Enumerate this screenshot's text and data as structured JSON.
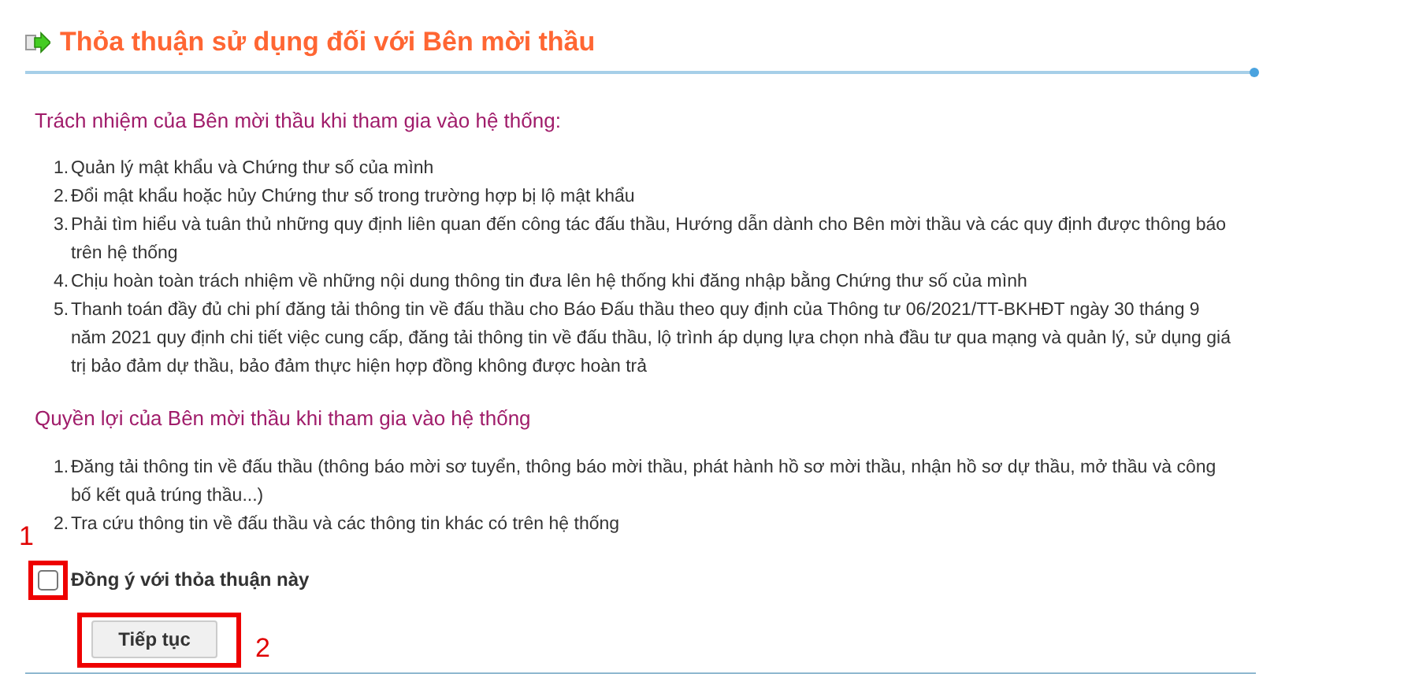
{
  "title": "Thỏa thuận sử dụng đối với Bên mời thầu",
  "sections": [
    {
      "heading": "Trách nhiệm của Bên mời thầu khi tham gia vào hệ thống:",
      "items": [
        {
          "number": "1.",
          "text": "Quản lý mật khẩu và Chứng thư số của mình"
        },
        {
          "number": "2.",
          "text": "Đổi mật khẩu hoặc hủy Chứng thư số trong trường hợp bị lộ mật khẩu"
        },
        {
          "number": "3.",
          "text": "Phải tìm hiểu và tuân thủ những quy định liên quan đến công tác đấu thầu, Hướng dẫn dành cho Bên mời thầu và các quy định được thông báo trên hệ thống"
        },
        {
          "number": "4.",
          "text": "Chịu hoàn toàn trách nhiệm về những nội dung thông tin đưa lên hệ thống khi đăng nhập bằng Chứng thư số của mình"
        },
        {
          "number": "5.",
          "text": "Thanh toán đầy đủ chi phí đăng tải thông tin về đấu thầu cho Báo Đấu thầu theo quy định của Thông tư 06/2021/TT-BKHĐT ngày 30 tháng 9 năm 2021 quy định chi tiết việc cung cấp, đăng tải thông tin về đấu thầu, lộ trình áp dụng lựa chọn nhà đầu tư qua mạng và quản lý, sử dụng giá trị bảo đảm dự thầu, bảo đảm thực hiện hợp đồng không được hoàn trả"
        }
      ]
    },
    {
      "heading": "Quyền lợi của Bên mời thầu khi tham gia vào hệ thống",
      "items": [
        {
          "number": "1.",
          "text": "Đăng tải thông tin về đấu thầu (thông báo mời sơ tuyển, thông báo mời thầu, phát hành hồ sơ mời thầu, nhận hồ sơ dự thầu, mở thầu và công bố kết quả trúng thầu...)"
        },
        {
          "number": "2.",
          "text": "Tra cứu thông tin về đấu thầu và các thông tin khác có trên hệ thống"
        }
      ]
    }
  ],
  "agree": {
    "label": "Đồng ý với thỏa thuận này",
    "checked": false,
    "annotation": "1"
  },
  "continue_button": {
    "label": "Tiếp tục",
    "annotation": "2"
  }
}
